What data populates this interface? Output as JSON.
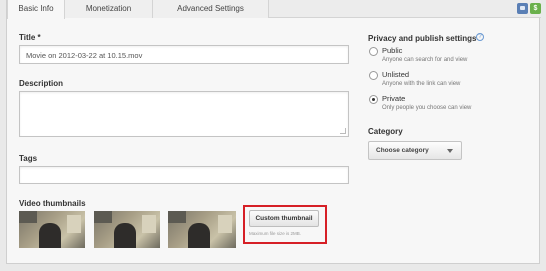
{
  "tabs": [
    {
      "label": "Basic Info",
      "active": true
    },
    {
      "label": "Monetization",
      "active": false
    },
    {
      "label": "Advanced Settings",
      "active": false
    }
  ],
  "header_icons": {
    "first": "publish-icon",
    "second_label": "$"
  },
  "title_field": {
    "label": "Title *",
    "value": "Movie on 2012-03-22 at 10.15.mov"
  },
  "description_field": {
    "label": "Description",
    "value": ""
  },
  "tags_field": {
    "label": "Tags",
    "value": ""
  },
  "thumbnails": {
    "label": "Video thumbnails",
    "custom_button": "Custom thumbnail",
    "max_size_note": "Maximum file size is 2MB."
  },
  "privacy": {
    "title": "Privacy and publish settings",
    "options": [
      {
        "label": "Public",
        "desc": "Anyone can search for and view",
        "checked": false
      },
      {
        "label": "Unlisted",
        "desc": "Anyone with the link can view",
        "checked": false
      },
      {
        "label": "Private",
        "desc": "Only people you choose can view",
        "checked": true
      }
    ]
  },
  "category": {
    "label": "Category",
    "selected": "Choose category"
  },
  "colors": {
    "highlight": "#d61f26",
    "help": "#6b9ad2"
  }
}
